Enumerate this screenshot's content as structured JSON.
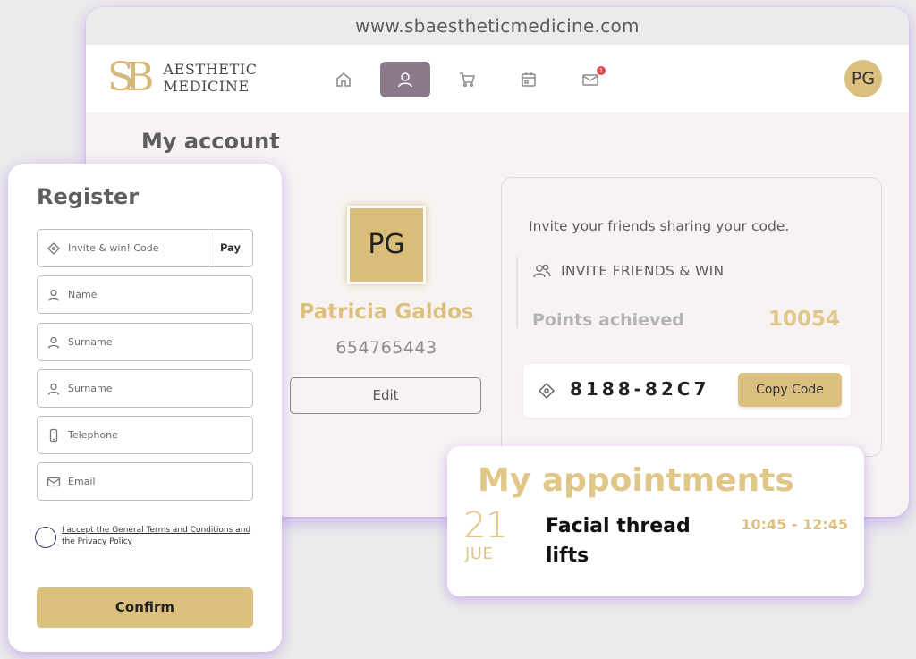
{
  "browser": {
    "url": "www.sbaestheticmedicine.com"
  },
  "header": {
    "logo_mark": "SB",
    "logo_line1": "AESTHETIC",
    "logo_line2": "MEDICINE",
    "nav": [
      {
        "icon": "home-icon"
      },
      {
        "icon": "user-icon",
        "active": true
      },
      {
        "icon": "cart-icon"
      },
      {
        "icon": "calendar-icon"
      },
      {
        "icon": "mail-icon",
        "badge": "1"
      }
    ],
    "avatar": "PG"
  },
  "account": {
    "title": "My account",
    "initials": "PG",
    "name": "Patricia Galdos",
    "phone": "654765443",
    "edit_label": "Edit"
  },
  "invite": {
    "prompt": "Invite your friends sharing your code.",
    "heading": "INVITE FRIENDS & WIN",
    "points_label": "Points achieved",
    "points_value": "10054",
    "code": "8188-82C7",
    "copy_label": "Copy Code"
  },
  "register": {
    "title": "Register",
    "invite_placeholder": "Invite & win! Code",
    "pay_label": "Pay",
    "name_placeholder": "Name",
    "surname_placeholder": "Surname",
    "surname2_placeholder": "Surname",
    "telephone_placeholder": "Telephone",
    "email_placeholder": "Email",
    "terms_text": "I accept the General Terms and Conditions and the Privacy Policy",
    "confirm_label": "Confirm"
  },
  "appointments": {
    "title": "My appointments",
    "day": "21",
    "month": "JUE",
    "service": "Facial thread lifts",
    "time": "10:45 - 12:45"
  },
  "colors": {
    "gold": "#dcc07f",
    "active_nav": "#8c7a8b",
    "shadow": "#aa82e6"
  }
}
